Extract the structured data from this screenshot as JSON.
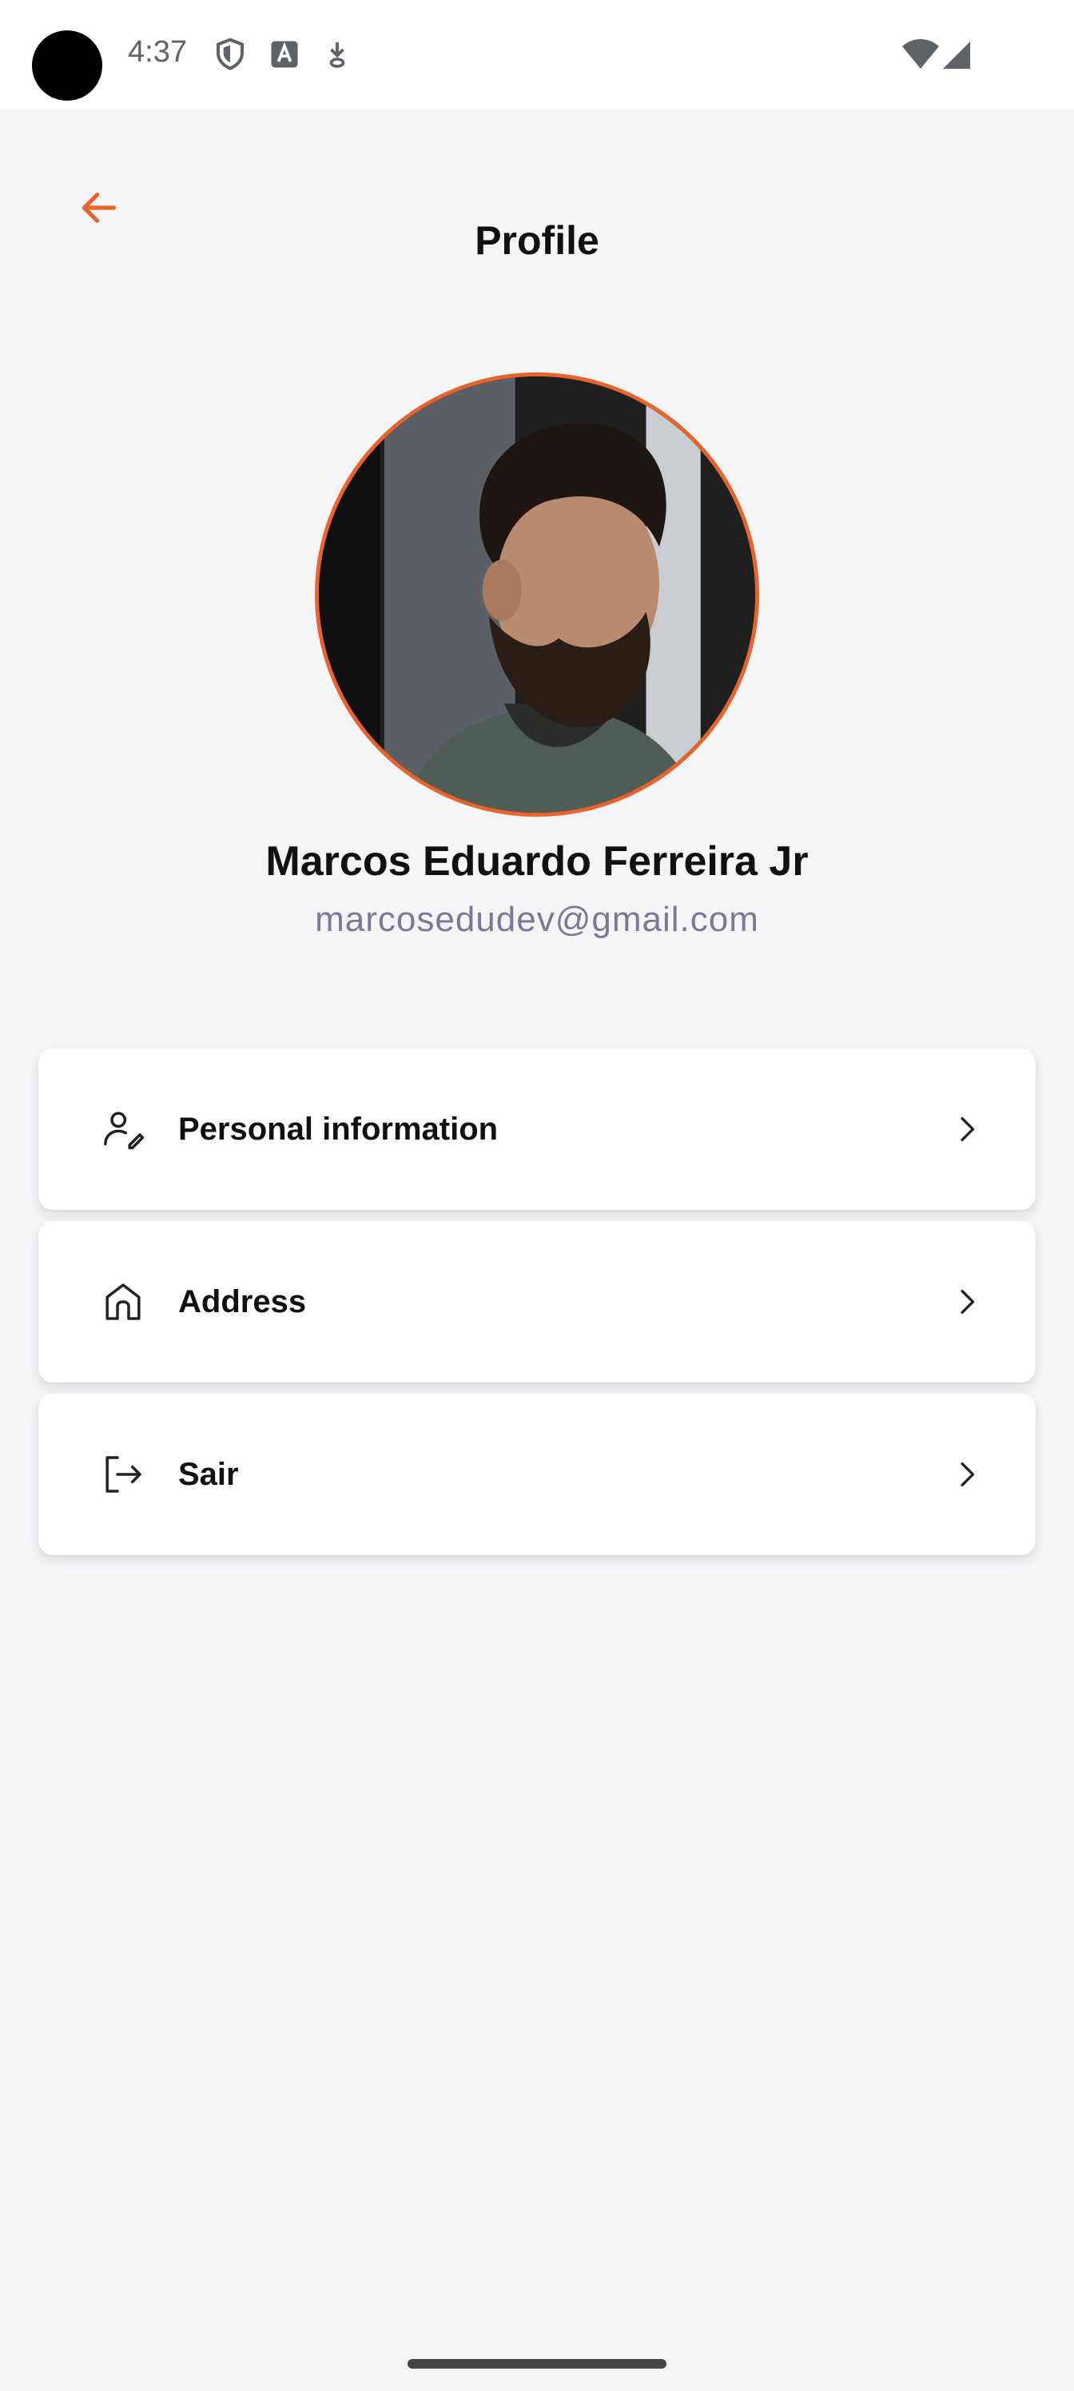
{
  "status_bar": {
    "time": "4:37",
    "icons": [
      "shield-icon",
      "font-a-icon",
      "download-icon",
      "wifi-icon",
      "signal-icon"
    ]
  },
  "header": {
    "title": "Profile",
    "back_icon": "arrow-left-icon"
  },
  "profile": {
    "name": "Marcos Eduardo Ferreira Jr",
    "email": "marcosedudev@gmail.com"
  },
  "menu": {
    "items": [
      {
        "label": "Personal information",
        "icon": "user-edit-icon"
      },
      {
        "label": "Address",
        "icon": "home-icon"
      },
      {
        "label": "Sair",
        "icon": "logout-icon"
      }
    ]
  },
  "colors": {
    "accent": "#e8642c",
    "background": "#f5f5f8",
    "card": "#ffffff",
    "email_text": "#7a7a96"
  }
}
